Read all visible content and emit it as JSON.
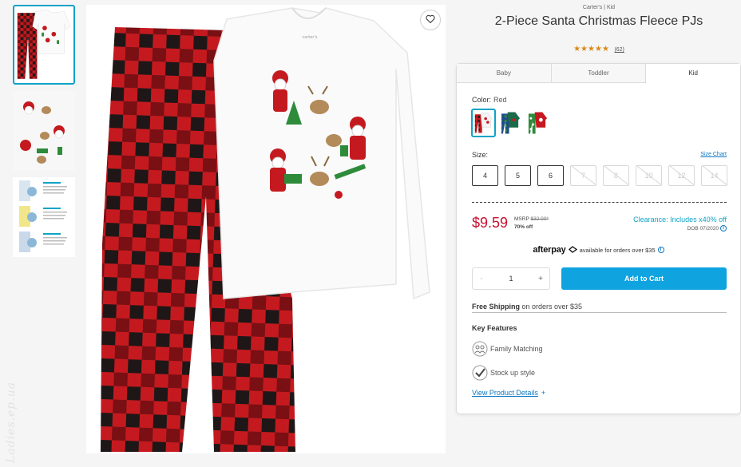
{
  "brand": {
    "company": "Carter's",
    "separator": " | ",
    "category": "Kid"
  },
  "product": {
    "title": "2-Piece Santa Christmas Fleece PJs",
    "stars": "★★★★★",
    "rating_value": 4.5,
    "review_count": "(62)"
  },
  "tabs": [
    {
      "label": "Baby"
    },
    {
      "label": "Toddler"
    },
    {
      "label": "Kid",
      "active": true
    }
  ],
  "color": {
    "label": "Color:",
    "value": "Red"
  },
  "size": {
    "label": "Size:",
    "chart_link": "Size Chart",
    "options": [
      {
        "label": "4",
        "available": true
      },
      {
        "label": "5",
        "available": true
      },
      {
        "label": "6",
        "available": true
      },
      {
        "label": "7",
        "available": false
      },
      {
        "label": "8",
        "available": false
      },
      {
        "label": "10",
        "available": false
      },
      {
        "label": "12",
        "available": false
      },
      {
        "label": "14",
        "available": false
      }
    ]
  },
  "pricing": {
    "price": "$9.59",
    "msrp_label": "MSRP",
    "msrp_value": "$32.00*",
    "discount": "70% off",
    "clearance": "Clearance: Includes x40% off",
    "dob": "DOB 07/2020"
  },
  "afterpay": {
    "logo": "afterpay",
    "text": "available for orders over $35"
  },
  "quantity": {
    "minus": "-",
    "value": "1",
    "plus": "+"
  },
  "cart_button": "Add to Cart",
  "shipping": {
    "bold": "Free Shipping",
    "text": " on orders over $35"
  },
  "key_features": {
    "title": "Key Features",
    "items": [
      {
        "label": "Family Matching",
        "icon": "family-icon"
      },
      {
        "label": "Stock up style",
        "icon": "checkmark-icon"
      }
    ]
  },
  "view_details": {
    "label": "View Product Details",
    "plus": "+"
  },
  "watermark": "Ladies.ep.ua",
  "colors": {
    "accent": "#0fa3c7",
    "price": "#c8102e",
    "cart": "#0fa3e0",
    "link": "#0a78c2",
    "plaid_red": "#c41a1f",
    "plaid_black": "#1a1a1a"
  }
}
